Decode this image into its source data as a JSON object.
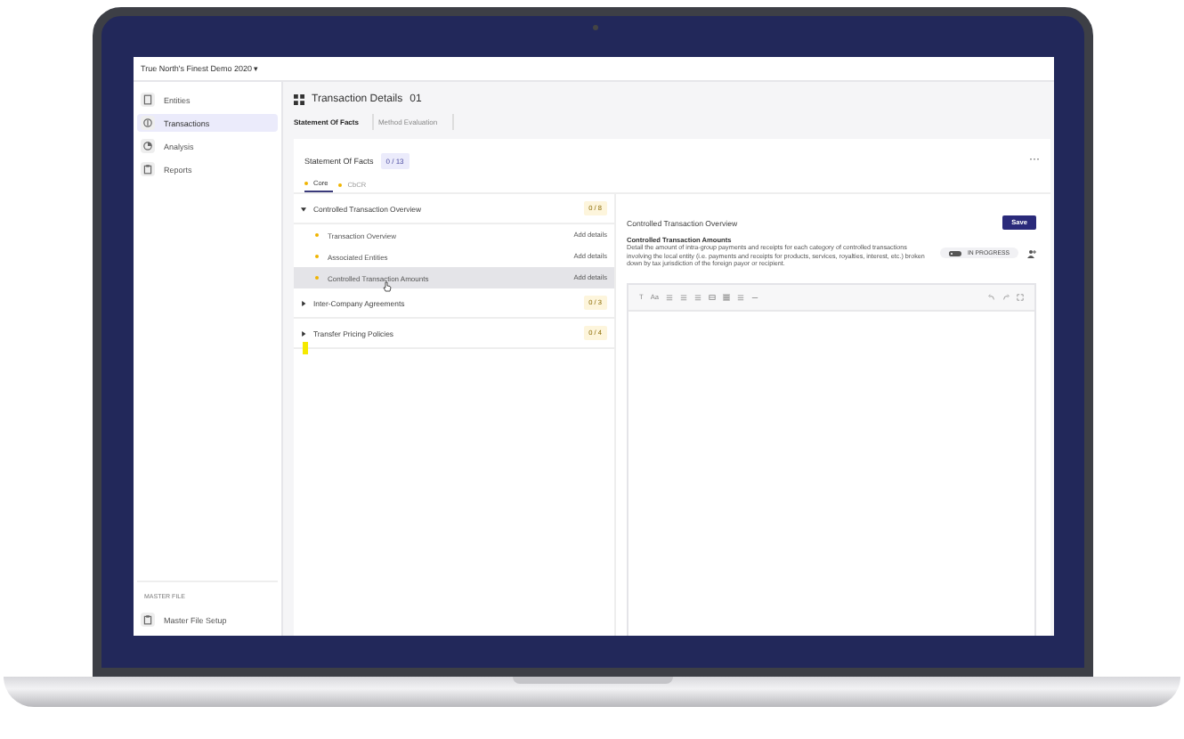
{
  "topbar": {
    "org_switcher": "True North's Finest Demo 2020 ▾"
  },
  "sidebar": {
    "items": [
      {
        "label": "Entities",
        "selected": false
      },
      {
        "label": "Transactions",
        "selected": true
      },
      {
        "label": "Analysis",
        "selected": false
      },
      {
        "label": "Reports",
        "selected": false
      }
    ],
    "footer": {
      "heading": "MASTER FILE",
      "item": "Master File Setup"
    }
  },
  "page": {
    "title": "Transaction Details",
    "number": "01",
    "steps": [
      {
        "label": "Statement Of Facts",
        "selected": true
      },
      {
        "label": "Method Evaluation",
        "selected": false
      }
    ]
  },
  "card": {
    "title": "Statement Of Facts",
    "progress": "0 / 13",
    "more": "···",
    "tabs": [
      {
        "label": "Core",
        "selected": true
      },
      {
        "label": "CbCR",
        "selected": false
      }
    ],
    "sections": [
      {
        "title": "Controlled Transaction Overview",
        "progress": "0 / 8",
        "expanded": true,
        "children": [
          {
            "label": "Transaction Overview",
            "action": "Add details",
            "selected": false
          },
          {
            "label": "Associated Entities",
            "action": "Add details",
            "selected": false
          },
          {
            "label": "Controlled Transaction Amounts",
            "action": "Add details",
            "selected": true
          }
        ]
      },
      {
        "title": "Inter-Company Agreements",
        "progress": "0 / 3",
        "expanded": false
      },
      {
        "title": "Transfer Pricing Policies",
        "progress": "0 / 4",
        "expanded": false
      }
    ],
    "detail": {
      "heading": "Controlled Transaction Overview",
      "save": "Save",
      "question": "Controlled Transaction Amounts",
      "description": "Detail the amount of intra-group payments and receipts for each category of controlled transactions involving the local entity (i.e. payments and receipts for products, services, royalties, interest, etc.) broken down by tax jurisdiction of the foreign payor or recipient.",
      "status": {
        "label": "IN PROGRESS",
        "on": false
      },
      "toolbar_labels": [
        "T",
        "Aa"
      ]
    }
  }
}
